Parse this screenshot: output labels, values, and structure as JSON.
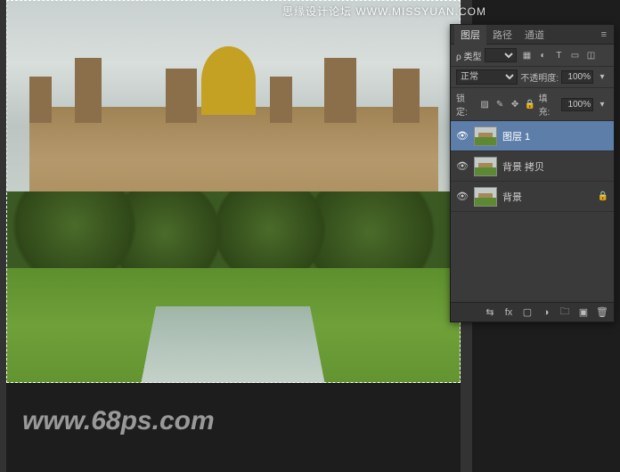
{
  "watermarks": {
    "top": "思缘设计论坛  WWW.MISSYUAN.COM",
    "bottom": "www.68ps.com"
  },
  "panel": {
    "tabs": {
      "layers": "图层",
      "channels": "路径",
      "paths": "通道"
    },
    "filter": {
      "kind_label": "ρ 类型",
      "kind_select": ""
    },
    "blend": {
      "mode": "正常",
      "opacity_label": "不透明度:",
      "opacity_value": "100%"
    },
    "lock": {
      "label": "锁定:",
      "fill_label": "填充:",
      "fill_value": "100%"
    },
    "layers": [
      {
        "name": "图层 1",
        "visible": true,
        "selected": true,
        "locked": false
      },
      {
        "name": "背景 拷贝",
        "visible": true,
        "selected": false,
        "locked": false
      },
      {
        "name": "背景",
        "visible": true,
        "selected": false,
        "locked": true
      }
    ]
  }
}
